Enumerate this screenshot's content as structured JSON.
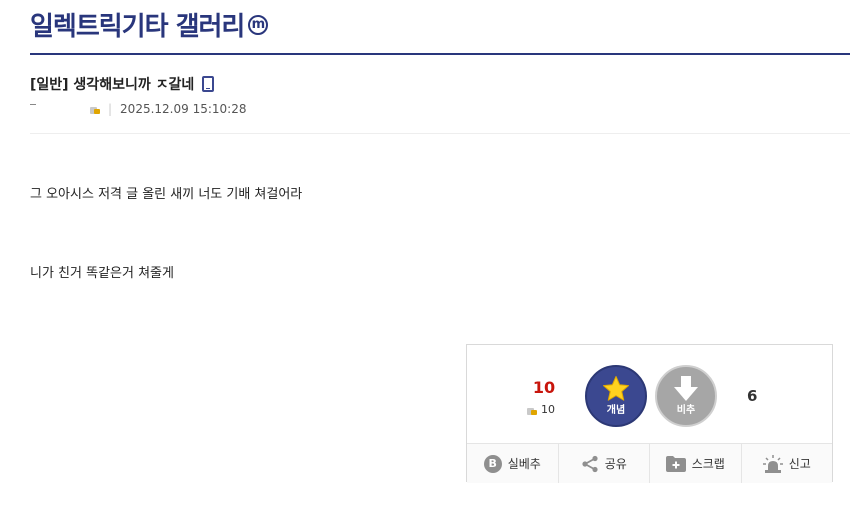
{
  "gallery": {
    "title": "일렉트릭기타 갤러리",
    "badge": "m"
  },
  "post": {
    "title": "[일반] 생각해보니까 ㅈ갈네",
    "date": "2025.12.09 15:10:28",
    "separator": "|",
    "body_lines": [
      "그 오아시스 저격 글 올린 새끼 너도 기배 쳐걸어라",
      "니가 친거 똑같은거 쳐줄게"
    ]
  },
  "recommend": {
    "up_count": "10",
    "fixed_up_count": "10",
    "up_label": "개념",
    "down_label": "비추",
    "down_count": "6"
  },
  "actions": [
    {
      "label": "실베추",
      "icon": "b-circle-icon"
    },
    {
      "label": "공유",
      "icon": "share-icon"
    },
    {
      "label": "스크랩",
      "icon": "folder-plus-icon"
    },
    {
      "label": "신고",
      "icon": "siren-icon"
    }
  ],
  "colors": {
    "brand": "#29367c",
    "up": "#3b4890",
    "down": "#a6a6a6",
    "count_red": "#c8150c",
    "star": "#ffd21f"
  }
}
